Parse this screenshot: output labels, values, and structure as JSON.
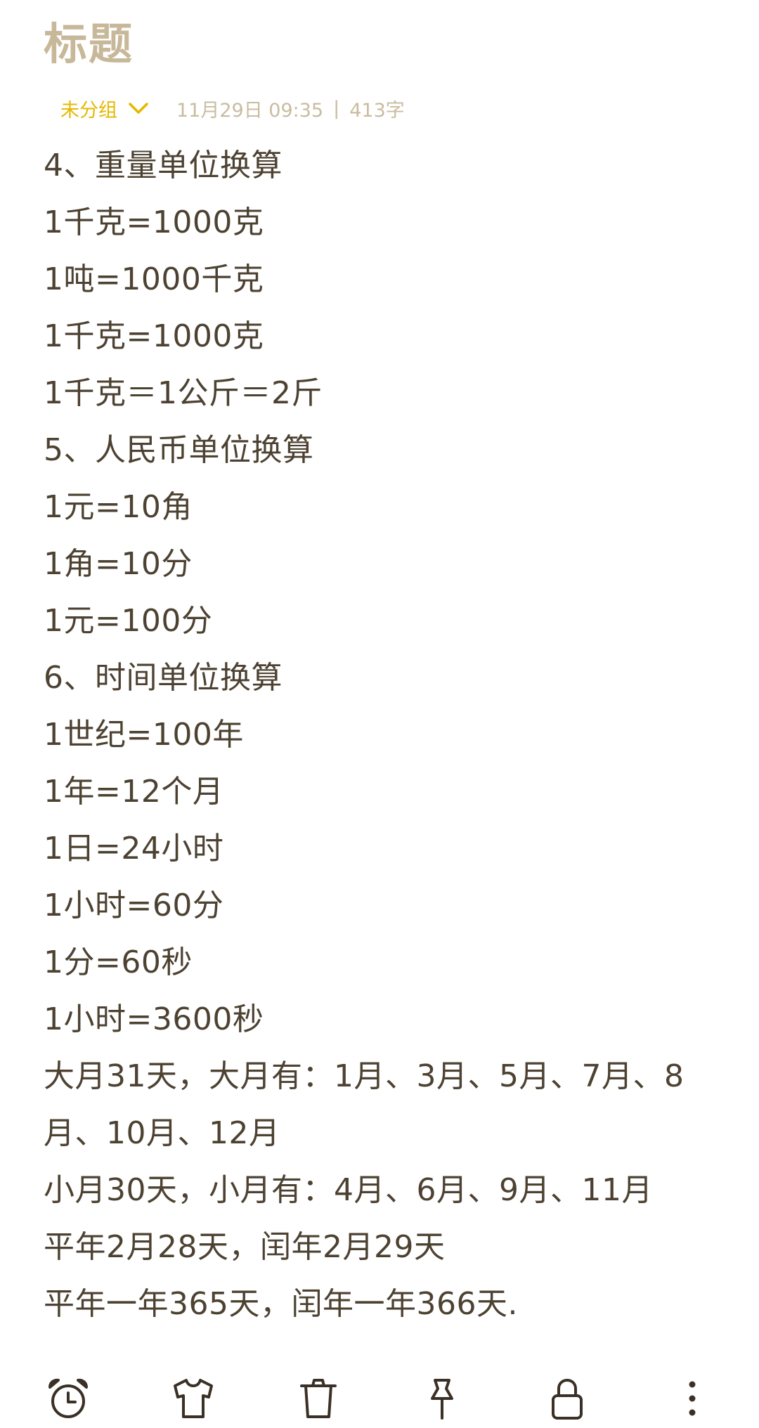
{
  "note": {
    "title": "标题",
    "group_label": "未分组",
    "date": "11月29日 09:35",
    "separator": "|",
    "word_count": "413字",
    "lines": [
      "4、重量单位换算",
      "1千克=1000克",
      "1吨=1000千克",
      "1千克=1000克",
      "1千克＝1公斤＝2斤",
      "5、人民币单位换算",
      "1元=10角",
      "1角=10分",
      "1元=100分",
      "6、时间单位换算",
      "1世纪=100年",
      "1年=12个月",
      "1日=24小时",
      "1小时=60分",
      "1分=60秒",
      "1小时=3600秒",
      "大月31天，大月有：1月、3月、5月、7月、8",
      "月、10月、12月",
      "小月30天，小月有：4月、6月、9月、11月",
      "平年2月28天，闰年2月29天",
      "平年一年365天，闰年一年366天."
    ]
  },
  "colors": {
    "title": "#c8b89a",
    "group": "#e6b800",
    "meta": "#c9bca0",
    "body_text": "#4d4232",
    "icons": "#3a3026"
  },
  "toolbar": [
    {
      "icon": "alarm-clock-icon"
    },
    {
      "icon": "shirt-icon"
    },
    {
      "icon": "trash-icon"
    },
    {
      "icon": "pin-icon"
    },
    {
      "icon": "lock-icon"
    },
    {
      "icon": "more-vertical-icon"
    }
  ]
}
